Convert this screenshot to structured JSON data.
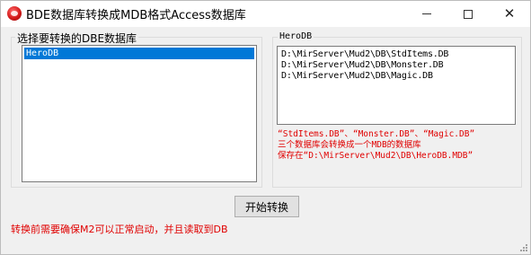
{
  "window": {
    "title": "BDE数据库转换成MDB格式Access数据库"
  },
  "icons": {
    "app": "app-icon",
    "minimize": "minimize-icon",
    "maximize": "maximize-icon",
    "close": "close-icon"
  },
  "left_group": {
    "legend": "选择要转换的DBE数据库",
    "items": [
      {
        "label": "HeroDB",
        "selected": true
      }
    ]
  },
  "right_group": {
    "legend": "HeroDB",
    "items": [
      {
        "label": "D:\\MirServer\\Mud2\\DB\\StdItems.DB"
      },
      {
        "label": "D:\\MirServer\\Mud2\\DB\\Monster.DB"
      },
      {
        "label": "D:\\MirServer\\Mud2\\DB\\Magic.DB"
      }
    ],
    "note_lines": [
      "“StdItems.DB”、“Monster.DB”、“Magic.DB”",
      "三个数据库会转换成一个MDB的数据库",
      "保存在“D:\\MirServer\\Mud2\\DB\\HeroDB.MDB”"
    ]
  },
  "actions": {
    "convert_label": "开始转换"
  },
  "warning": "转换前需要确保M2可以正常启动，并且读取到DB",
  "colors": {
    "selection": "#0078d7",
    "warning_text": "#e00000",
    "window_bg": "#f0f0f0"
  }
}
